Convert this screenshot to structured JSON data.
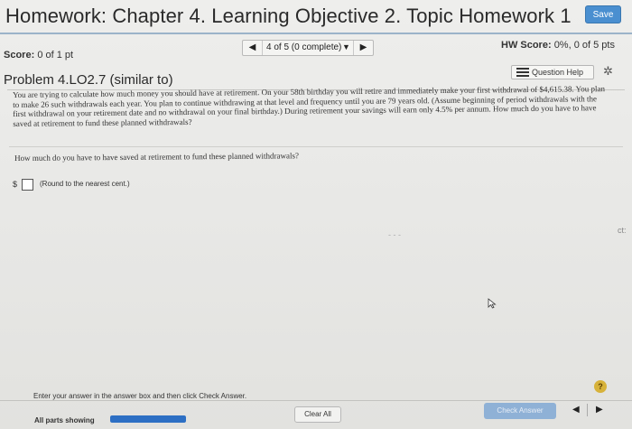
{
  "header": {
    "title": "Homework: Chapter 4. Learning Objective 2. Topic Homework 1",
    "save_label": "Save",
    "accent_color": "#4a8fd0"
  },
  "score_row": {
    "score_label": "Score:",
    "score_value": "0 of 1 pt",
    "nav_prev_icon": "triangle-left-icon",
    "nav_text": "4 of 5 (0 complete)",
    "nav_dropdown_icon": "caret-down-icon",
    "nav_next_icon": "triangle-right-icon",
    "hw_score_label": "HW Score:",
    "hw_score_value": "0%, 0 of 5 pts"
  },
  "problem": {
    "title": "Problem 4.LO2.7 (similar to)",
    "question_help_label": "Question Help",
    "question_help_icon": "list-icon",
    "settings_icon": "gear-icon",
    "text": "You are trying to calculate how much money you should have at retirement. On your 58th birthday you will retire and immediately make your first withdrawal of $4,615.38. You plan to make 26 such withdrawals each year. You plan to continue withdrawing at that level and frequency until you are 79 years old. (Assume beginning of period withdrawals with the first withdrawal on your retirement date and no withdrawal on your final birthday.) During retirement your savings will earn only 4.5% per annum. How much do you have to have saved at retirement to fund these planned withdrawals?",
    "question": "How much do you have to have saved at retirement to fund these planned withdrawals?",
    "answer_prefix": "$",
    "answer_value": "",
    "round_note": "(Round to the nearest cent.)"
  },
  "edge_text": "ct:",
  "footer": {
    "instruction": "Enter your answer in the answer box and then click Check Answer.",
    "help_label": "?",
    "all_parts_label": "All parts showing",
    "progress_fraction": 1.0,
    "clear_all_label": "Clear All",
    "check_answer_label": "Check Answer",
    "prev_icon": "triangle-left-icon",
    "next_icon": "triangle-right-icon"
  }
}
